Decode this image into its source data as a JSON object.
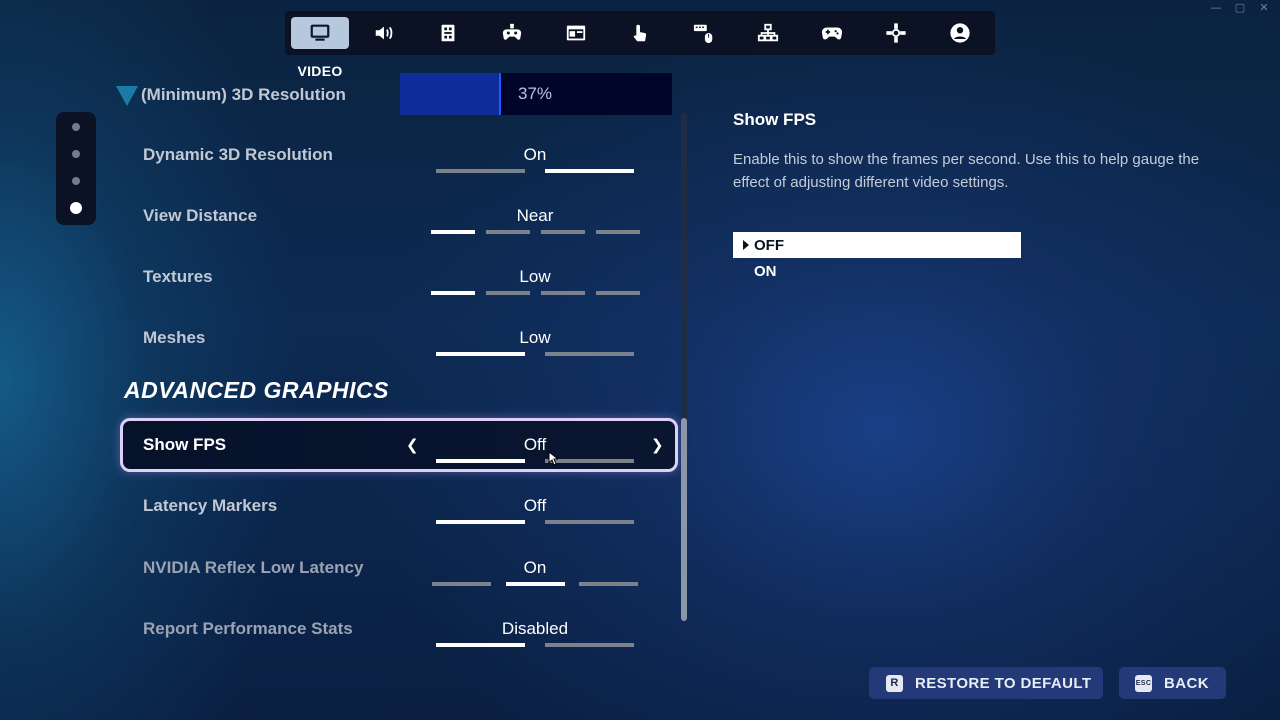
{
  "window_controls": {
    "minimize": "—",
    "maximize": "▢",
    "close": "✕"
  },
  "tabs": {
    "active_label": "VIDEO",
    "items": [
      {
        "icon": "monitor-icon",
        "active": true
      },
      {
        "icon": "speaker-icon",
        "active": false
      },
      {
        "icon": "game-settings-icon",
        "active": false
      },
      {
        "icon": "controller-settings-icon",
        "active": false
      },
      {
        "icon": "window-layout-icon",
        "active": false
      },
      {
        "icon": "touch-icon",
        "active": false
      },
      {
        "icon": "keyboard-mouse-icon",
        "active": false
      },
      {
        "icon": "hierarchy-icon",
        "active": false
      },
      {
        "icon": "gamepad-icon",
        "active": false
      },
      {
        "icon": "dpad-icon",
        "active": false
      },
      {
        "icon": "account-icon",
        "active": false
      }
    ]
  },
  "settings": {
    "min_resolution": {
      "label": "(Minimum) 3D Resolution",
      "value": "37%",
      "fill_percent": 37
    },
    "dynamic_resolution": {
      "label": "Dynamic 3D Resolution",
      "value": "On",
      "segments": 2,
      "selected_index": 1
    },
    "view_distance": {
      "label": "View Distance",
      "value": "Near",
      "segments": 4,
      "selected_index": 0
    },
    "textures": {
      "label": "Textures",
      "value": "Low",
      "segments": 4,
      "selected_index": 0
    },
    "meshes": {
      "label": "Meshes",
      "value": "Low",
      "segments": 2,
      "selected_index": 0
    },
    "section_title": "ADVANCED GRAPHICS",
    "show_fps": {
      "label": "Show FPS",
      "value": "Off",
      "segments": 2,
      "selected_index": 0
    },
    "latency_markers": {
      "label": "Latency Markers",
      "value": "Off",
      "segments": 2,
      "selected_index": 0
    },
    "nvidia_reflex": {
      "label": "NVIDIA Reflex Low Latency",
      "value": "On",
      "segments": 3,
      "selected_index": 1
    },
    "report_perf": {
      "label": "Report Performance Stats",
      "value": "Disabled",
      "segments": 2,
      "selected_index": 0
    }
  },
  "description": {
    "title": "Show FPS",
    "text": "Enable this to show the frames per second. Use this to help gauge the effect of adjusting different video settings.",
    "options": [
      "OFF",
      "ON"
    ],
    "selected_option": "OFF"
  },
  "footer": {
    "restore_key": "R",
    "restore_label": "RESTORE TO DEFAULT",
    "back_key": "ESC",
    "back_label": "BACK"
  },
  "colors": {
    "accent_blue": "#243a78",
    "selection_outline": "#ddd0f5",
    "resolution_fill": "#0f2d98"
  }
}
